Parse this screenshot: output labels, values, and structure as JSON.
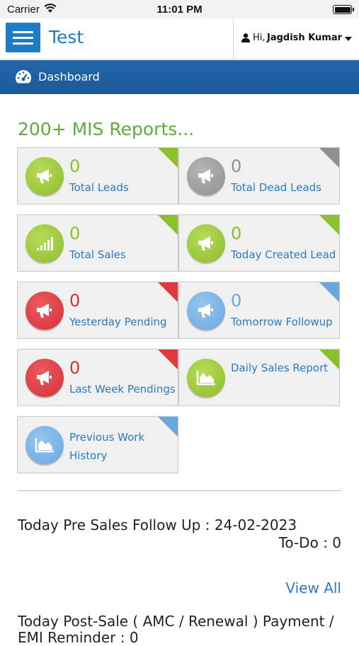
{
  "status_bar": {
    "carrier": "Carrier",
    "time": "11:01 PM"
  },
  "app": {
    "title": "Test"
  },
  "user": {
    "greeting": "Hi,",
    "name": "Jagdish Kumar"
  },
  "nav": {
    "dashboard_label": "Dashboard"
  },
  "heading": "200+ MIS Reports...",
  "colors": {
    "brand_blue": "#1f7bc2",
    "green": "#8dbd2a",
    "gray": "#8f8f8f",
    "red": "#d33138",
    "light_blue": "#6aa8de"
  },
  "cards": [
    {
      "count": "0",
      "label": "Total Leads",
      "color": "green",
      "icon": "megaphone-icon"
    },
    {
      "count": "0",
      "label": "Total Dead Leads",
      "color": "gray",
      "icon": "megaphone-icon"
    },
    {
      "count": "0",
      "label": "Total Sales",
      "color": "green",
      "icon": "signal-bars-icon"
    },
    {
      "count": "0",
      "label": "Today Created Lead",
      "color": "green",
      "icon": "megaphone-icon"
    },
    {
      "count": "0",
      "label": "Yesterday Pending",
      "color": "red",
      "icon": "megaphone-icon"
    },
    {
      "count": "0",
      "label": "Tomorrow Followup",
      "color": "light_blue",
      "icon": "megaphone-icon"
    },
    {
      "count": "0",
      "label": "Last Week Pendings",
      "color": "red",
      "icon": "megaphone-icon"
    },
    {
      "label": "Daily Sales Report",
      "color": "green",
      "icon": "area-chart-icon"
    },
    {
      "label_line1": "Previous Work",
      "label_line2": "History",
      "color": "light_blue",
      "icon": "area-chart-icon"
    }
  ],
  "pre_sales": {
    "title": "Today Pre Sales Follow Up : 24-02-2023",
    "todo": "To-Do : 0",
    "view_all": "View All"
  },
  "post_sale": {
    "title": "Today Post-Sale ( AMC / Renewal ) Payment / EMI Reminder : 0"
  }
}
